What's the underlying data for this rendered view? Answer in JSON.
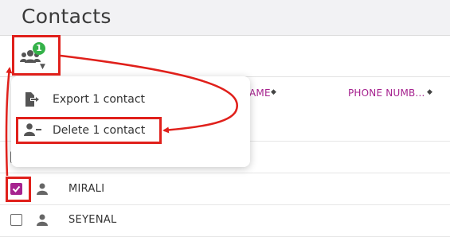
{
  "header": {
    "title": "Contacts"
  },
  "toolbar": {
    "selected_count": "1",
    "bulk_icon": "people-group-icon"
  },
  "table": {
    "columns": [
      {
        "label": "AME",
        "sort_icon": "sort-icon"
      },
      {
        "label": "PHONE NUMB…",
        "sort_icon": "sort-icon"
      }
    ],
    "rows": [
      {
        "name": "",
        "checked": false
      },
      {
        "name": "",
        "checked": false
      },
      {
        "name": "MIRALI",
        "checked": true
      },
      {
        "name": "SEYENAL",
        "checked": false
      }
    ],
    "hidden_phone_placeholder": "-"
  },
  "menu": {
    "items": [
      {
        "label": "Export 1 contact",
        "icon": "export-file-icon"
      },
      {
        "label": "Delete 1 contact",
        "icon": "remove-user-icon"
      }
    ]
  },
  "colors": {
    "accent": "#a6238f",
    "badge": "#35b24a",
    "highlight": "#e0201b"
  }
}
